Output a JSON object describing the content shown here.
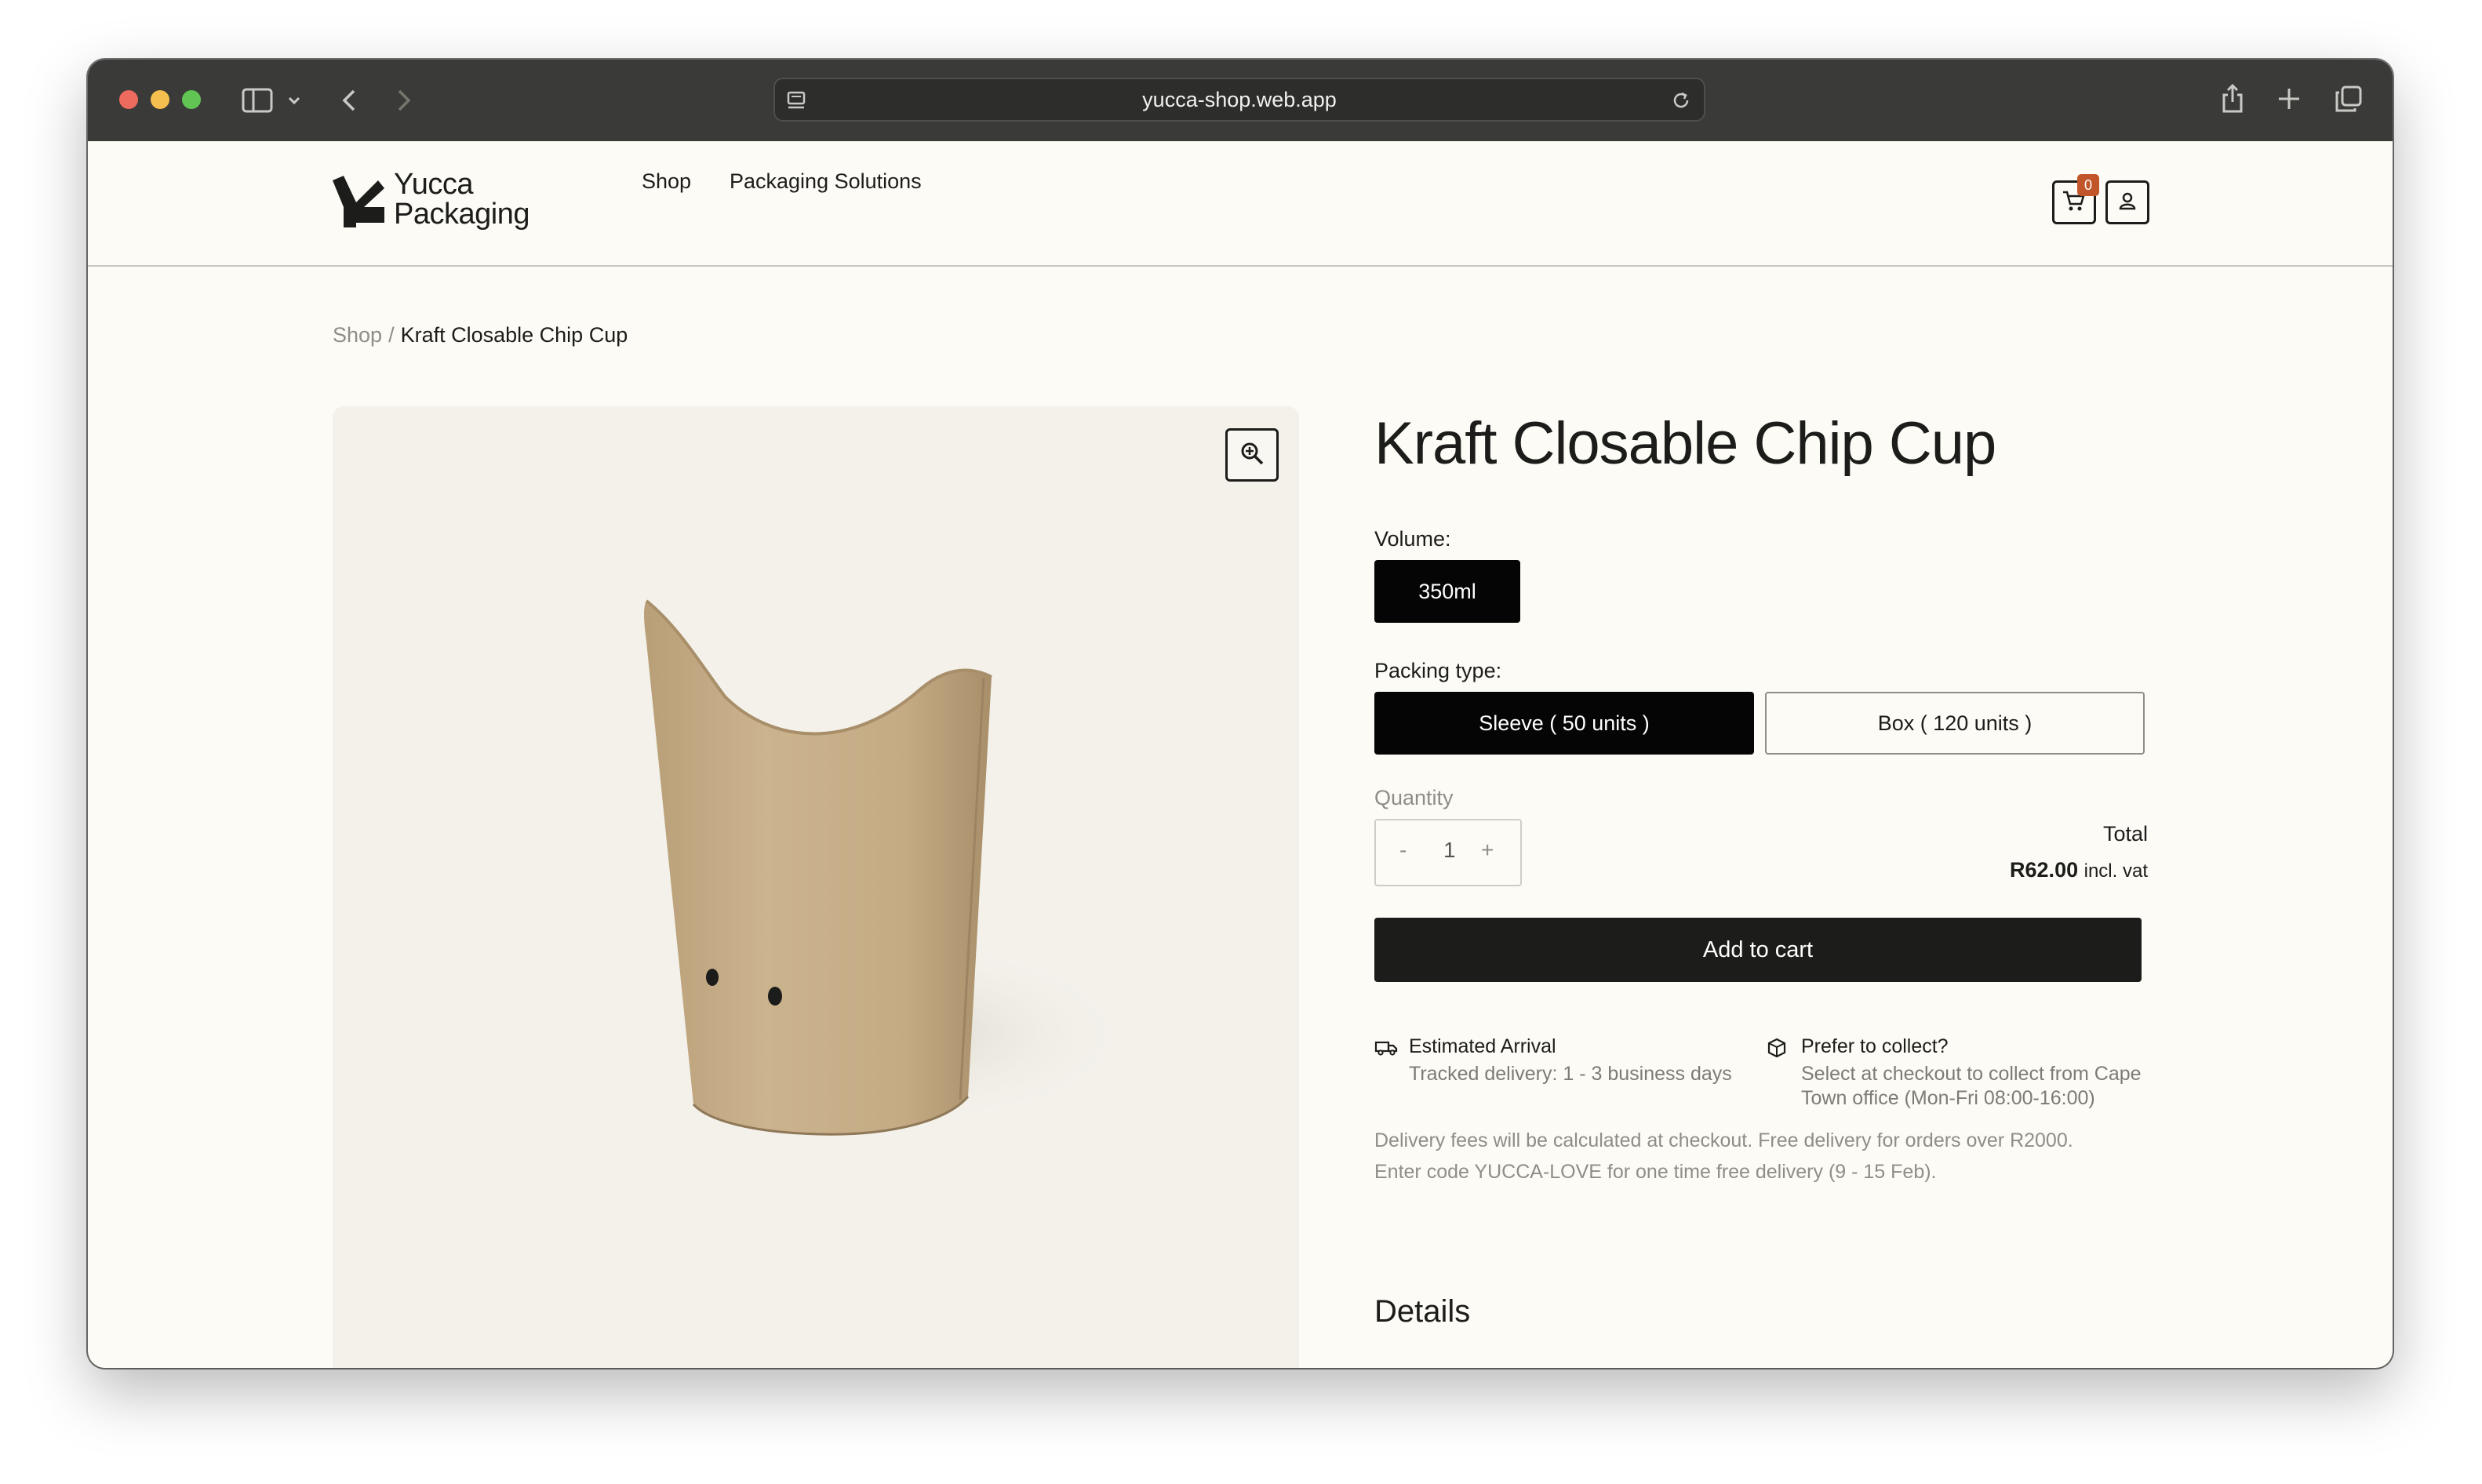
{
  "browser": {
    "url": "yucca-shop.web.app"
  },
  "site": {
    "logo_line1": "Yucca",
    "logo_line2": "Packaging",
    "nav": [
      {
        "label": "Shop"
      },
      {
        "label": "Packaging Solutions"
      }
    ],
    "cart_count": "0"
  },
  "breadcrumb": {
    "parent": "Shop",
    "separator": "/",
    "current": "Kraft Closable Chip Cup"
  },
  "product": {
    "title": "Kraft Closable Chip Cup",
    "volume_label": "Volume:",
    "volume_options": [
      {
        "label": "350ml",
        "selected": true
      }
    ],
    "packing_label": "Packing type:",
    "packing_options": [
      {
        "label": "Sleeve ( 50 units )",
        "selected": true
      },
      {
        "label": "Box ( 120 units )",
        "selected": false
      }
    ],
    "quantity_label": "Quantity",
    "quantity": {
      "minus": "-",
      "value": "1",
      "plus": "+"
    },
    "total_label": "Total",
    "total_amount": "R62.00",
    "total_suffix": "incl. vat",
    "add_to_cart": "Add to cart",
    "arrival_title": "Estimated Arrival",
    "arrival_text": "Tracked delivery: 1 - 3 business days",
    "collect_title": "Prefer to collect?",
    "collect_text_1": "Select at checkout to collect from Cape",
    "collect_text_2": "Town office (Mon-Fri 08:00-16:00)",
    "note_1": "Delivery fees will be calculated at checkout. Free delivery for orders over R2000.",
    "note_2": "Enter code YUCCA-LOVE for one time free delivery (9 - 15 Feb).",
    "details_heading": "Details"
  },
  "colors": {
    "page_bg": "#fcfbf5",
    "accent_dark": "#1c1c1a",
    "badge": "#c0562a",
    "kraft": "#c8b08c"
  }
}
